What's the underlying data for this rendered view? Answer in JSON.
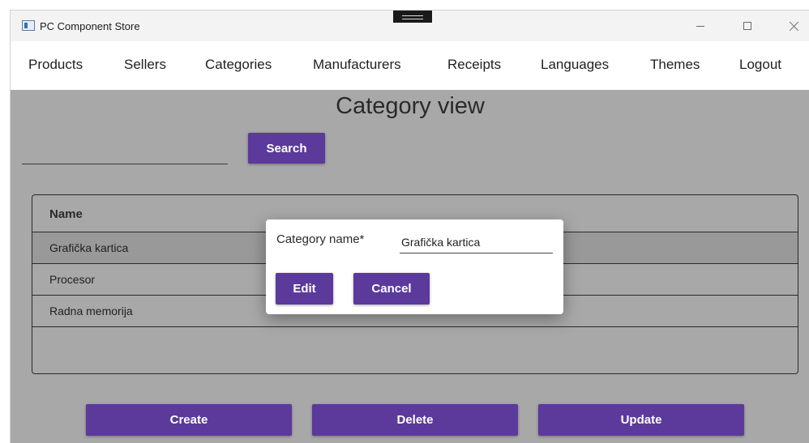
{
  "window": {
    "title": "PC Component Store"
  },
  "menu": {
    "items": [
      {
        "label": "Products"
      },
      {
        "label": "Sellers"
      },
      {
        "label": "Categories"
      },
      {
        "label": "Manufacturers"
      },
      {
        "label": "Receipts"
      },
      {
        "label": "Languages"
      },
      {
        "label": "Themes"
      },
      {
        "label": "Logout"
      }
    ]
  },
  "page": {
    "title": "Category view",
    "search_value": "",
    "search_label": "Search"
  },
  "table": {
    "header": "Name",
    "rows": [
      {
        "name": "Grafička kartica",
        "selected": true
      },
      {
        "name": "Procesor",
        "selected": false
      },
      {
        "name": "Radna memorija",
        "selected": false
      }
    ]
  },
  "actions": {
    "create": "Create",
    "delete": "Delete",
    "update": "Update"
  },
  "dialog": {
    "label": "Category name*",
    "value": "Grafička kartica",
    "edit": "Edit",
    "cancel": "Cancel"
  },
  "colors": {
    "accent": "#5b3a9c",
    "overlay": "#a8a8a8"
  }
}
